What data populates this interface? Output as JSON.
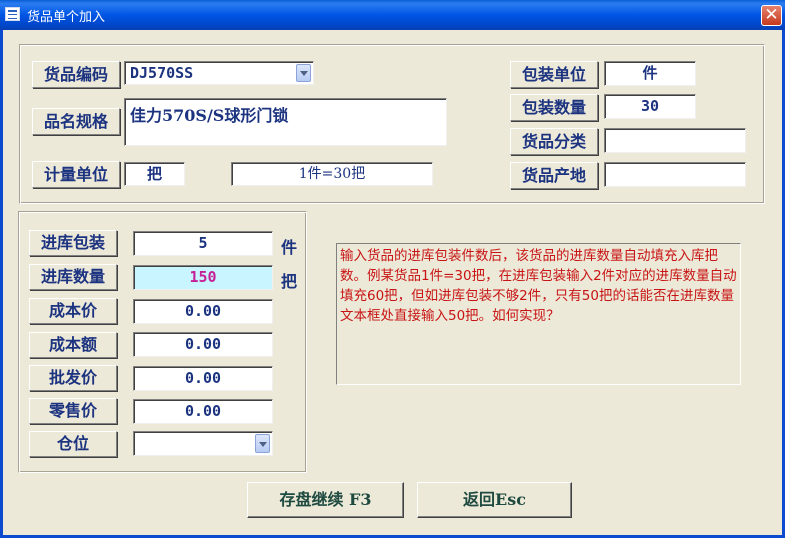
{
  "window": {
    "title": "货品单个加入",
    "close_glyph": "✕"
  },
  "header": {
    "code_label": "货品编码",
    "code_value": "DJ570SS",
    "name_label": "品名规格",
    "name_value": "佳力570S/S球形门锁",
    "measure_label": "计量单位",
    "measure_value": "把",
    "conversion_value": "1件=30把",
    "pack_unit_label": "包装单位",
    "pack_unit_value": "件",
    "pack_qty_label": "包装数量",
    "pack_qty_value": "30",
    "category_label": "货品分类",
    "category_value": "",
    "origin_label": "货品产地",
    "origin_value": ""
  },
  "stock": {
    "in_pack_label": "进库包装",
    "in_pack_value": "5",
    "in_pack_unit": "件",
    "in_qty_label": "进库数量",
    "in_qty_value": "150",
    "in_qty_unit": "把",
    "cost_price_label": "成本价",
    "cost_price_value": "0.00",
    "cost_amount_label": "成本额",
    "cost_amount_value": "0.00",
    "wholesale_label": "批发价",
    "wholesale_value": "0.00",
    "retail_label": "零售价",
    "retail_value": "0.00",
    "location_label": "仓位",
    "location_value": ""
  },
  "note": "输入货品的进库包装件数后，该货品的进库数量自动填充入库把数。例某货品1件=30把，在进库包装输入2件对应的进库数量自动填充60把，但如进库包装不够2件，只有50把的话能否在进库数量文本框处直接输入50把。如何实现？",
  "buttons": {
    "save": "存盘继续 F3",
    "back": "返回Esc"
  }
}
